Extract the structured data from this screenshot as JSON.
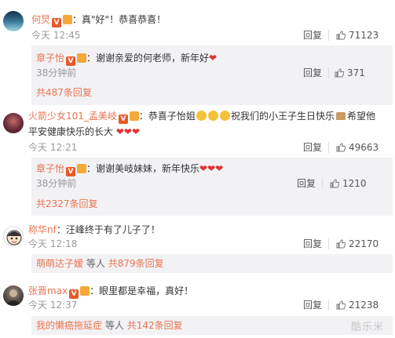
{
  "comments": [
    {
      "username": "何炅",
      "colon": "：",
      "text": "真\"好\"！恭喜恭喜！",
      "time": "今天 12:45",
      "reply_label": "回复",
      "likes": "71123"
    },
    {
      "username": "章子怡",
      "colon": "：",
      "text": "谢谢亲爱的何老师，新年好",
      "hearts": "❤",
      "time": "38分钟前",
      "reply_label": "回复",
      "likes": "371",
      "more": "共487条回复"
    },
    {
      "username": "火箭少女101_孟美岐",
      "colon": "：",
      "text_a": "恭喜子怡姐",
      "text_b": "祝我们的小王子生日快乐",
      "text_c": "希望他",
      "line2": "平安健康快乐的长大",
      "hearts": "❤❤❤",
      "time": "今天 12:21",
      "reply_label": "回复",
      "likes": "49663"
    },
    {
      "username": "章子怡",
      "colon": "：",
      "text": "谢谢美岐妹妹，新年快乐",
      "hearts": "❤❤❤",
      "time": "38分钟前",
      "reply_label": "回复",
      "likes": "1210",
      "more": "共2327条回复"
    },
    {
      "username": "称华nf",
      "colon": "：",
      "text": "汪峰终于有了儿子了！",
      "time": "今天 12:18",
      "reply_label": "回复",
      "likes": "22170",
      "more_user": "萌萌达子嫒",
      "more_mid": "等人",
      "more": "共879条回复"
    },
    {
      "username": "张晋max",
      "colon": "：",
      "text": "眼里都是幸福，真好！",
      "time": "今天 12:37",
      "reply_label": "回复",
      "likes": "21238",
      "more_user": "我的懒癌拖延症",
      "more_mid": "等人",
      "more": "共142条回复"
    }
  ],
  "watermark": "酷乐米",
  "colors": {
    "username": "#eb7350",
    "heart": "#e0322f",
    "subbg": "#f2f2f5"
  },
  "icons": [
    "like-thumb-icon",
    "verified-v-icon",
    "crown-icon",
    "emoji-icon",
    "cake-icon"
  ]
}
